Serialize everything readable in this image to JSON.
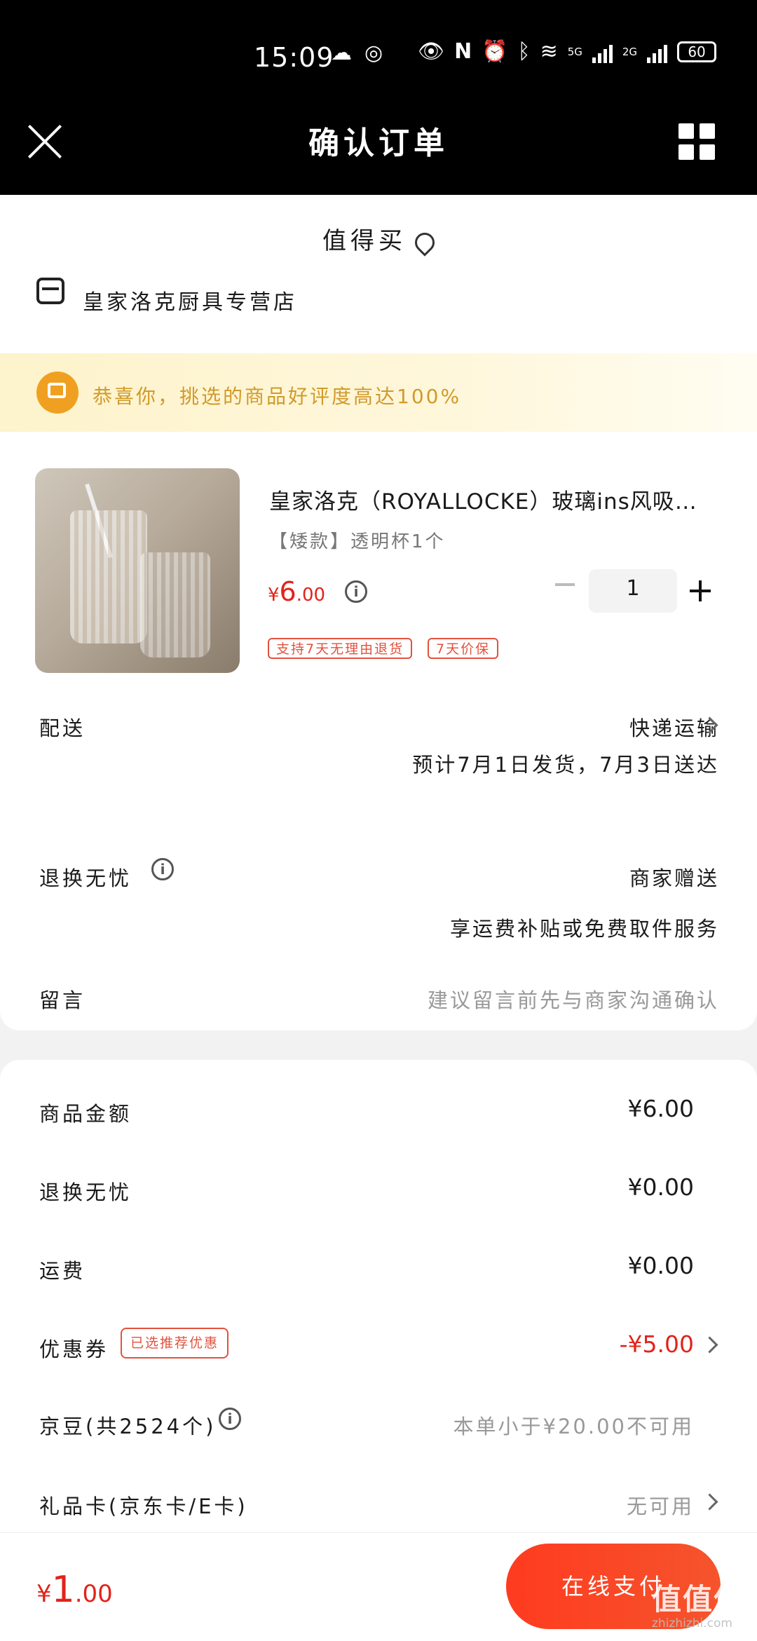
{
  "status_bar": {
    "time": "15:09",
    "notification_icons": [
      "wechat-icon",
      "zhi-app-icon"
    ],
    "indicators": [
      "eye-icon",
      "nfc-icon",
      "alarm-icon",
      "bluetooth-icon",
      "wifi-icon"
    ],
    "signal1_label": "5G",
    "signal2_label": "2G",
    "battery": "60"
  },
  "header": {
    "title": "确认订单"
  },
  "zdm_label": "值得买",
  "shop": {
    "name": "皇家洛克厨具专营店"
  },
  "banner": {
    "text": "恭喜你，挑选的商品好评度高达100%"
  },
  "product": {
    "title": "皇家洛克（ROYALLOCKE）玻璃ins风吸…",
    "spec": "【矮款】透明杯1个",
    "currency": "¥",
    "price_int": "6",
    "price_dec": ".00",
    "quantity": "1",
    "tags": [
      "支持7天无理由退货",
      "7天价保"
    ]
  },
  "delivery": {
    "label": "配送",
    "method": "快递运输",
    "eta": "预计7月1日发货，7月3日送达"
  },
  "return_service": {
    "label": "退换无忧",
    "value": "商家赠送",
    "note": "享运费补贴或免费取件服务"
  },
  "message": {
    "label": "留言",
    "placeholder": "建议留言前先与商家沟通确认"
  },
  "summary": {
    "goods_amount": {
      "label": "商品金额",
      "value": "¥6.00"
    },
    "return_fee": {
      "label": "退换无忧",
      "value": "¥0.00"
    },
    "shipping": {
      "label": "运费",
      "value": "¥0.00"
    },
    "coupon": {
      "label": "优惠券",
      "tag": "已选推荐优惠",
      "value": "-¥5.00"
    },
    "jd_beans": {
      "label": "京豆(共2524个)",
      "value": "本单小于¥20.00不可用"
    },
    "gift_card": {
      "label": "礼品卡(京东卡/E卡)",
      "value": "无可用"
    }
  },
  "footer": {
    "currency": "¥",
    "total_int": "1",
    "total_dec": ".00",
    "pay_label": "在线支付"
  },
  "watermark": {
    "logo": "值值值",
    "site": "zhizhizhi.com"
  },
  "colors": {
    "accent_red": "#e2231a",
    "banner_gold": "#d19a2a",
    "pay_gradient_start": "#ff3b1f"
  }
}
